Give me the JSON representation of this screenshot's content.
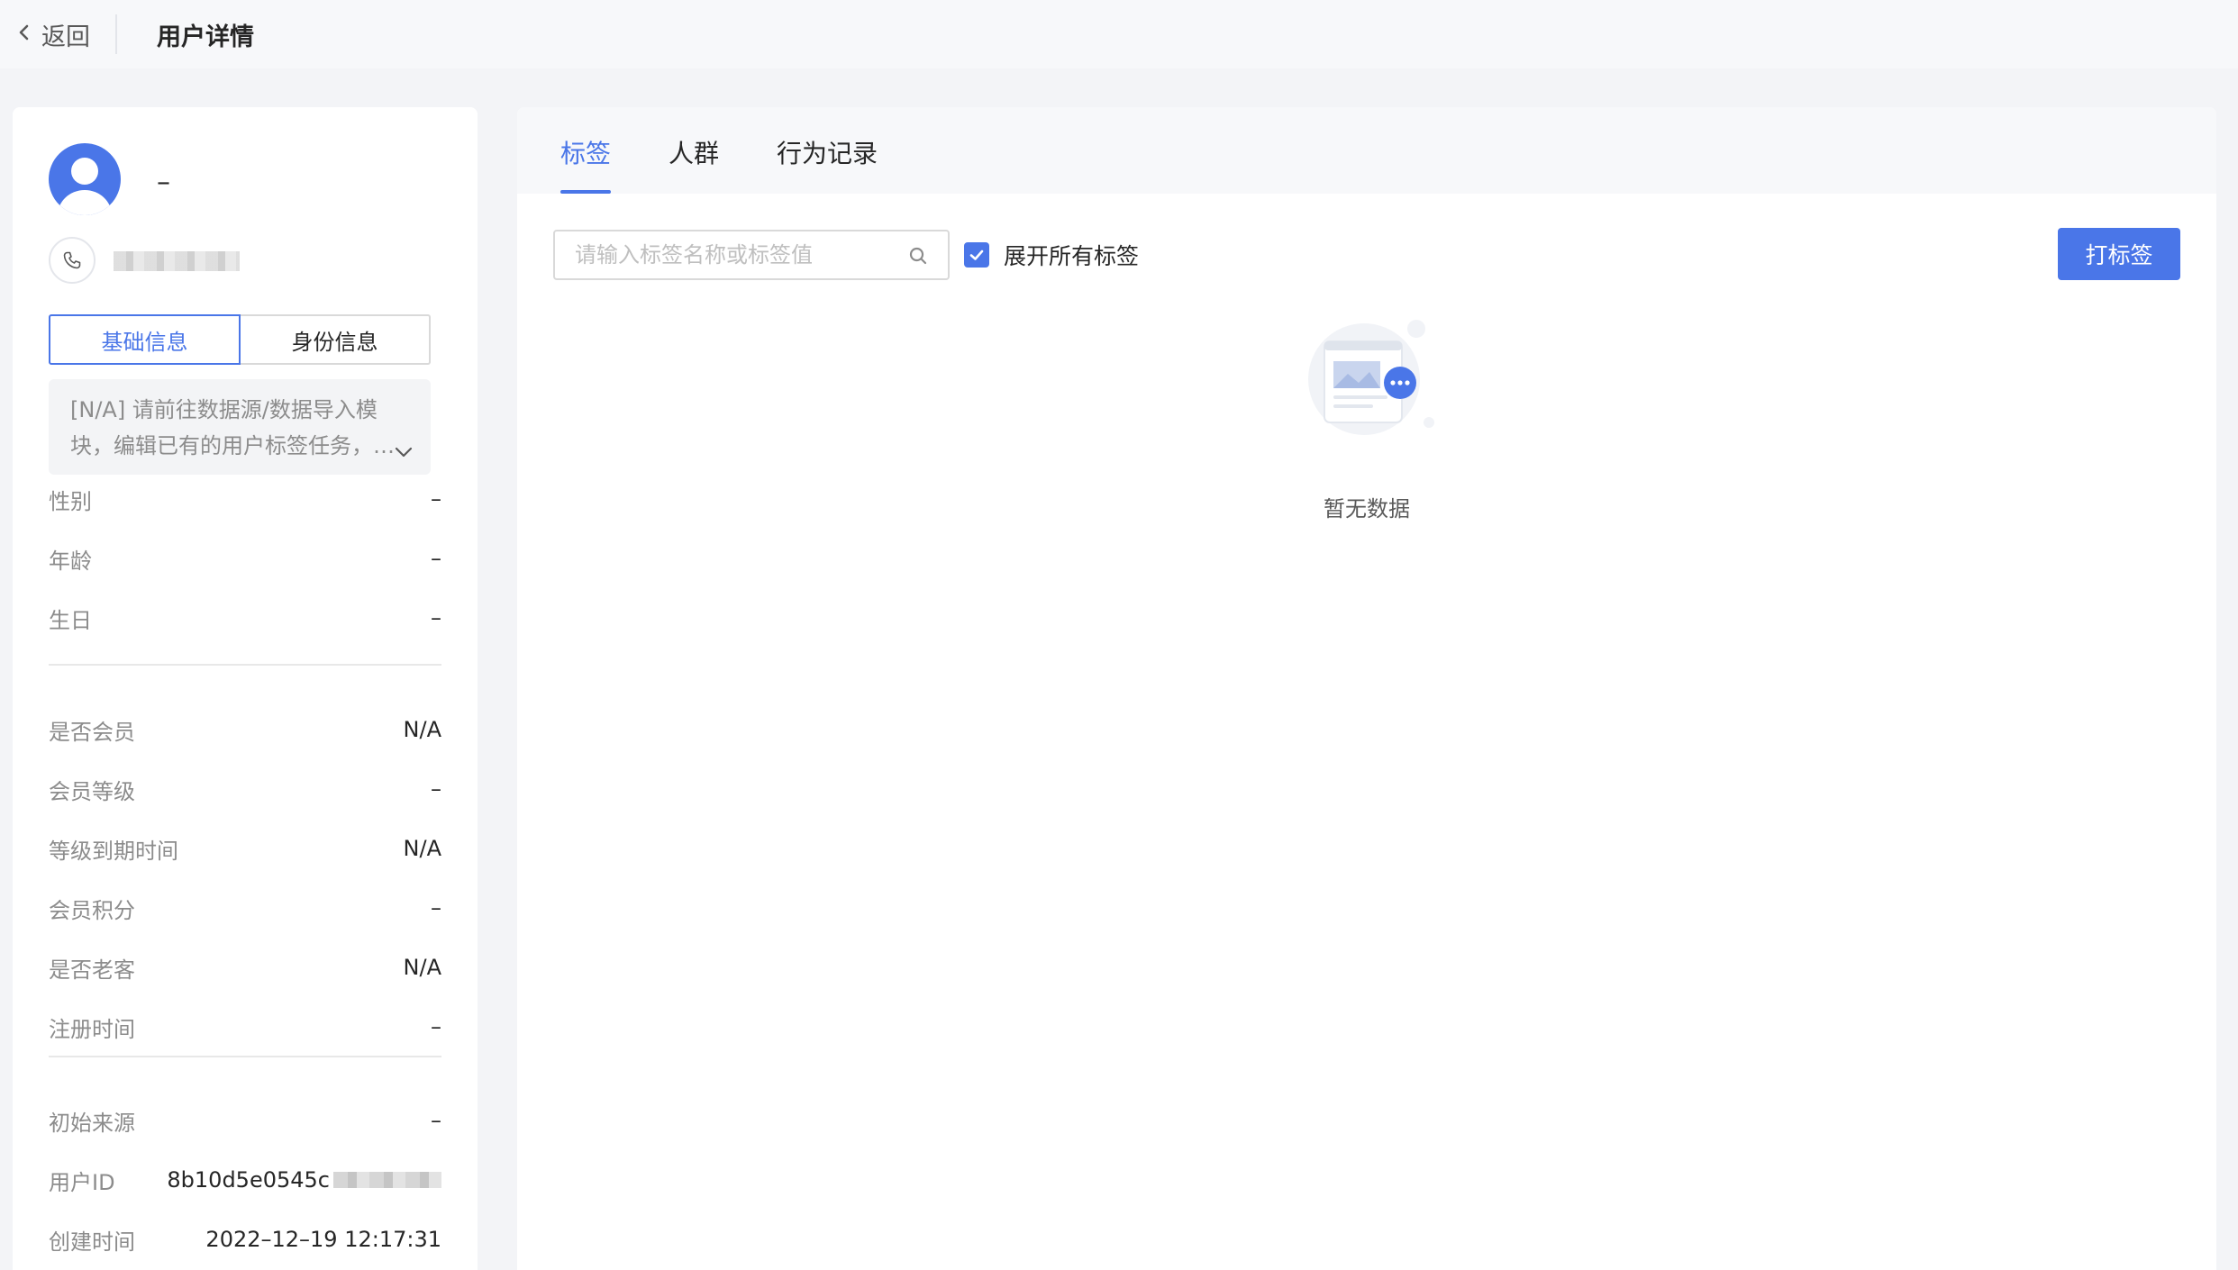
{
  "header": {
    "back_label": "返回",
    "title": "用户详情"
  },
  "profile": {
    "name": "–",
    "phone": "",
    "segment": {
      "basic": "基础信息",
      "identity": "身份信息"
    },
    "notice": {
      "line1": "[N/A] 请前往数据源/数据导入模",
      "line2": "块，编辑已有的用户标签任务，…"
    },
    "fields_group1": [
      {
        "label": "性别",
        "value": "–"
      },
      {
        "label": "年龄",
        "value": "–"
      },
      {
        "label": "生日",
        "value": "–"
      }
    ],
    "fields_group2": [
      {
        "label": "是否会员",
        "value": "N/A"
      },
      {
        "label": "会员等级",
        "value": "–"
      },
      {
        "label": "等级到期时间",
        "value": "N/A"
      },
      {
        "label": "会员积分",
        "value": "–"
      },
      {
        "label": "是否老客",
        "value": "N/A"
      },
      {
        "label": "注册时间",
        "value": "–"
      }
    ],
    "fields_group3": [
      {
        "label": "初始来源",
        "value": "–"
      },
      {
        "label": "用户ID",
        "value": "8b10d5e0545c"
      },
      {
        "label": "创建时间",
        "value": "2022–12–19 12:17:31"
      }
    ]
  },
  "tabs": [
    "标签",
    "人群",
    "行为记录"
  ],
  "toolbar": {
    "search_placeholder": "请输入标签名称或标签值",
    "expand_all_label": "展开所有标签",
    "expand_all_checked": true,
    "tag_button_label": "打标签"
  },
  "empty_state": {
    "text": "暂无数据"
  },
  "colors": {
    "accent": "#4a76e8",
    "page_bg": "#f3f4f7",
    "muted_text": "#8c8c8c"
  }
}
